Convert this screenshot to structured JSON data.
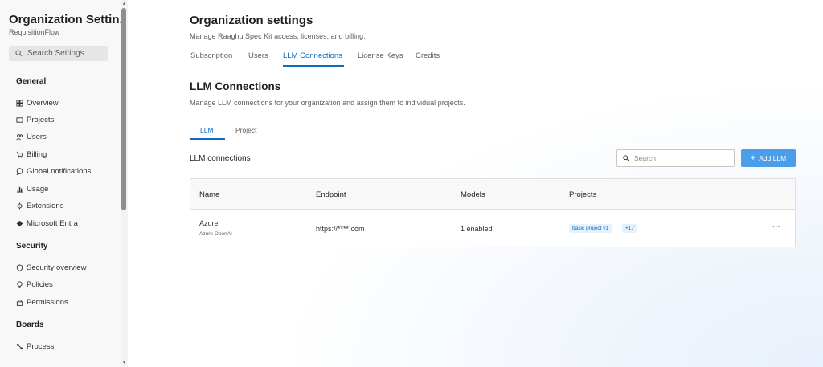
{
  "sidebar": {
    "title": "Organization Settin...",
    "subtitle": "RequisitionFlow",
    "search_placeholder": "Search Settings",
    "sections": [
      {
        "heading": "General",
        "items": [
          {
            "label": "Overview",
            "icon": "grid-icon"
          },
          {
            "label": "Projects",
            "icon": "projects-icon"
          },
          {
            "label": "Users",
            "icon": "users-icon"
          },
          {
            "label": "Billing",
            "icon": "cart-icon"
          },
          {
            "label": "Global notifications",
            "icon": "chat-icon"
          },
          {
            "label": "Usage",
            "icon": "chart-icon"
          },
          {
            "label": "Extensions",
            "icon": "gear-icon"
          },
          {
            "label": "Microsoft Entra",
            "icon": "diamond-icon"
          }
        ]
      },
      {
        "heading": "Security",
        "items": [
          {
            "label": "Security overview",
            "icon": "shield-icon"
          },
          {
            "label": "Policies",
            "icon": "bulb-icon"
          },
          {
            "label": "Permissions",
            "icon": "lock-icon"
          }
        ]
      },
      {
        "heading": "Boards",
        "items": [
          {
            "label": "Process",
            "icon": "process-icon"
          }
        ]
      }
    ]
  },
  "header": {
    "title": "Organization settings",
    "subtitle": "Manage Raaghu Spec Kit access, licenses, and billing.",
    "tabs": [
      {
        "label": "Subscription",
        "active": false
      },
      {
        "label": "Users",
        "active": false
      },
      {
        "label": "LLM Connections",
        "active": true
      },
      {
        "label": "License Keys",
        "active": false
      },
      {
        "label": "Credits",
        "active": false
      }
    ]
  },
  "section": {
    "title": "LLM Connections",
    "subtitle": "Manage LLM connections for your organization and assign them to individual projects.",
    "subtabs": [
      {
        "label": "LLM",
        "active": true
      },
      {
        "label": "Project",
        "active": false
      }
    ],
    "connections_label": "LLM connections",
    "search_placeholder": "Search",
    "add_button_label": "Add LLM"
  },
  "table": {
    "columns": [
      "Name",
      "Endpoint",
      "Models",
      "Projects"
    ],
    "rows": [
      {
        "name": "Azure",
        "provider": "Azure OpenAI",
        "endpoint": "https://****.com",
        "models": "1 enabled",
        "projects": [
          "basic project v1"
        ],
        "more_projects": "+17",
        "more_label": "···"
      }
    ]
  },
  "colors": {
    "accent": "#0f6cbd",
    "button": "#4a9eea",
    "badge_bg": "#e5f1fb"
  }
}
